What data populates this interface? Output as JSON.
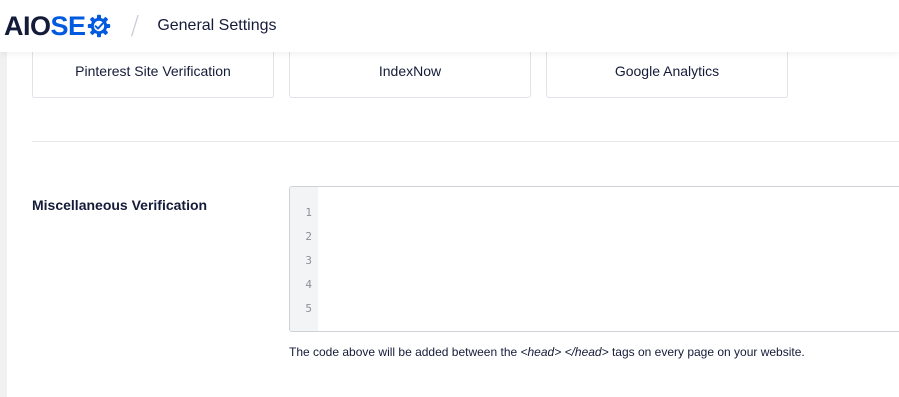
{
  "header": {
    "logo_aio": "AIO",
    "logo_seo": "SE",
    "separator": "/",
    "title": "General Settings",
    "logo_icon": "gear-icon",
    "brand_color": "#005ae0"
  },
  "cards": [
    {
      "label": "Pinterest Site Verification"
    },
    {
      "label": "IndexNow"
    },
    {
      "label": "Google Analytics"
    }
  ],
  "misc": {
    "label": "Miscellaneous Verification",
    "line_numbers": [
      "1",
      "2",
      "3",
      "4",
      "5"
    ],
    "help_prefix": "The code above will be added between the ",
    "help_tag_open": "<head>",
    "help_space": " ",
    "help_tag_close": "</head>",
    "help_suffix": " tags on every page on your website."
  }
}
